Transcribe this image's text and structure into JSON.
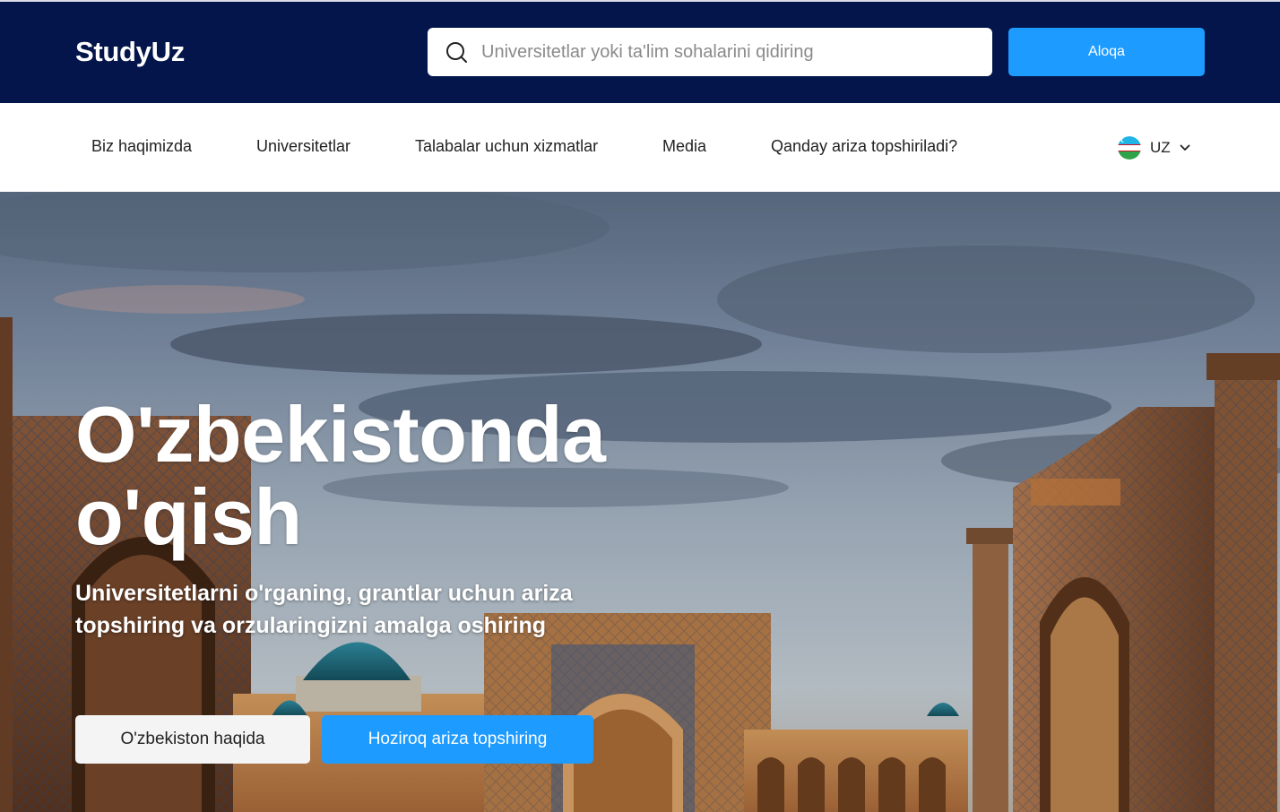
{
  "header": {
    "logo": "StudyUz",
    "search": {
      "placeholder": "Universitetlar yoki ta'lim sohalarini qidiring",
      "value": "",
      "icon": "search-icon"
    },
    "contact_label": "Aloqa"
  },
  "nav": {
    "items": [
      {
        "label": "Biz haqimizda"
      },
      {
        "label": "Universitetlar"
      },
      {
        "label": "Talabalar uchun xizmatlar"
      },
      {
        "label": "Media"
      },
      {
        "label": "Qanday ariza topshiriladi?"
      }
    ],
    "language": {
      "code": "UZ",
      "flag_icon": "uzbekistan-flag-icon",
      "dropdown_icon": "chevron-down-icon"
    }
  },
  "hero": {
    "title": "O'zbekistonda o'qish",
    "subtitle": "Universitetlarni o'rganing, grantlar uchun ariza topshiring va orzularingizni amalga oshiring",
    "primary_button": "Hoziroq ariza topshiring",
    "secondary_button": "O'zbekiston haqida"
  },
  "colors": {
    "header_bg": "#03154a",
    "accent": "#1e9bff",
    "nav_bg": "#ffffff"
  }
}
